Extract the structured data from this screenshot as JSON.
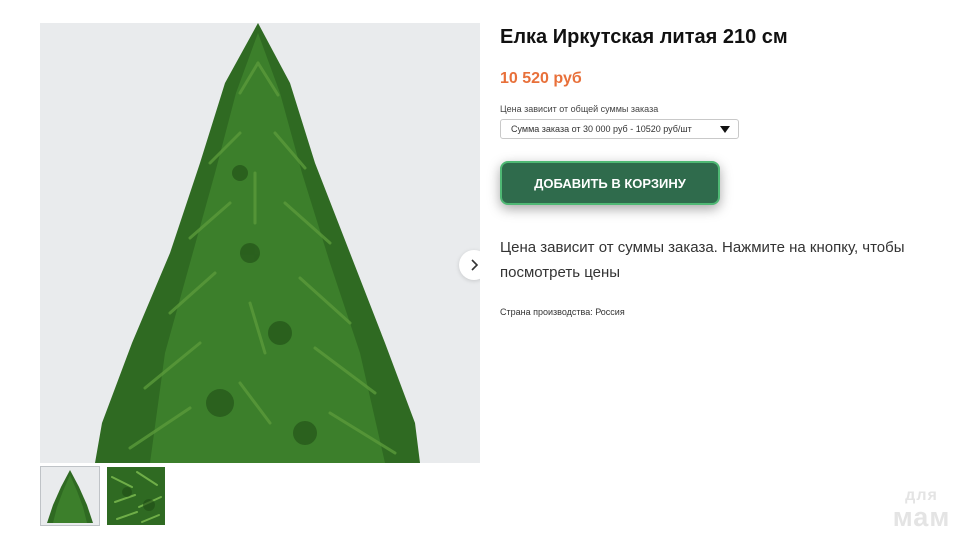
{
  "product": {
    "title": "Елка Иркутская литая 210 см",
    "price": "10 520 руб",
    "price_note": "Цена зависит от общей суммы заказа",
    "price_option_selected": "Сумма заказа от 30 000 руб - 10520 руб/шт",
    "add_to_cart_label": "ДОБАВИТЬ В КОРЗИНУ",
    "info_text": "Цена зависит от суммы заказа. Нажмите на кнопку, чтобы посмотреть цены",
    "country_label": "Страна производства: Россия"
  },
  "gallery": {
    "next_icon": "chevron-right-icon",
    "thumbnail_count": 2,
    "active_thumbnail": 1
  },
  "watermark": {
    "line1": "для",
    "line2": "мам"
  },
  "colors": {
    "price": "#e8703a",
    "button_bg": "#2f6b4c",
    "button_border": "#4fb874",
    "tree": "#2f6a22",
    "image_bg": "#e9ebed"
  }
}
